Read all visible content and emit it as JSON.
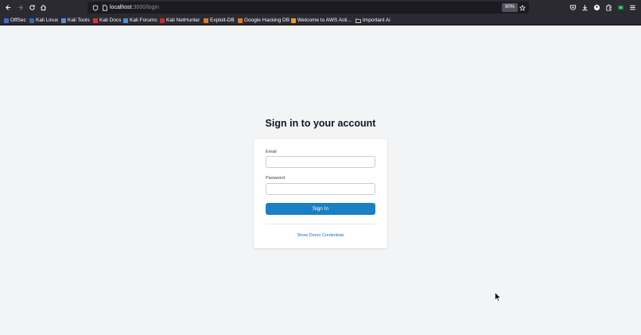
{
  "browser": {
    "url_host": "localhost",
    "url_path": ":3000/login",
    "zoom": "90%",
    "bookmarks": [
      {
        "label": "OffSec",
        "color": "#3d6ec9"
      },
      {
        "label": "Kali Linux",
        "color": "#2a6db5"
      },
      {
        "label": "Kali Tools",
        "color": "#5d8ad8"
      },
      {
        "label": "Kali Docs",
        "color": "#d9342b"
      },
      {
        "label": "Kali Forums",
        "color": "#4a90d9"
      },
      {
        "label": "Kali NetHunter",
        "color": "#c92a2a"
      },
      {
        "label": "Exploit-DB",
        "color": "#e07b24"
      },
      {
        "label": "Google Hacking DB",
        "color": "#e07b24"
      },
      {
        "label": "Welcome to AWS Acti...",
        "color": "#f19a1b"
      },
      {
        "label": "Important Ai",
        "color": "#fbfbfe"
      }
    ]
  },
  "login": {
    "title": "Sign in to your account",
    "email_label": "Email",
    "email_value": "",
    "password_label": "Password",
    "password_value": "",
    "submit_label": "Sign In",
    "demo_link": "Show Demo Credentials"
  },
  "colors": {
    "primary": "#1a7fc3",
    "link": "#1a6fc4",
    "page_bg": "#f3f4f6",
    "chrome_bg": "#2b2a33"
  }
}
